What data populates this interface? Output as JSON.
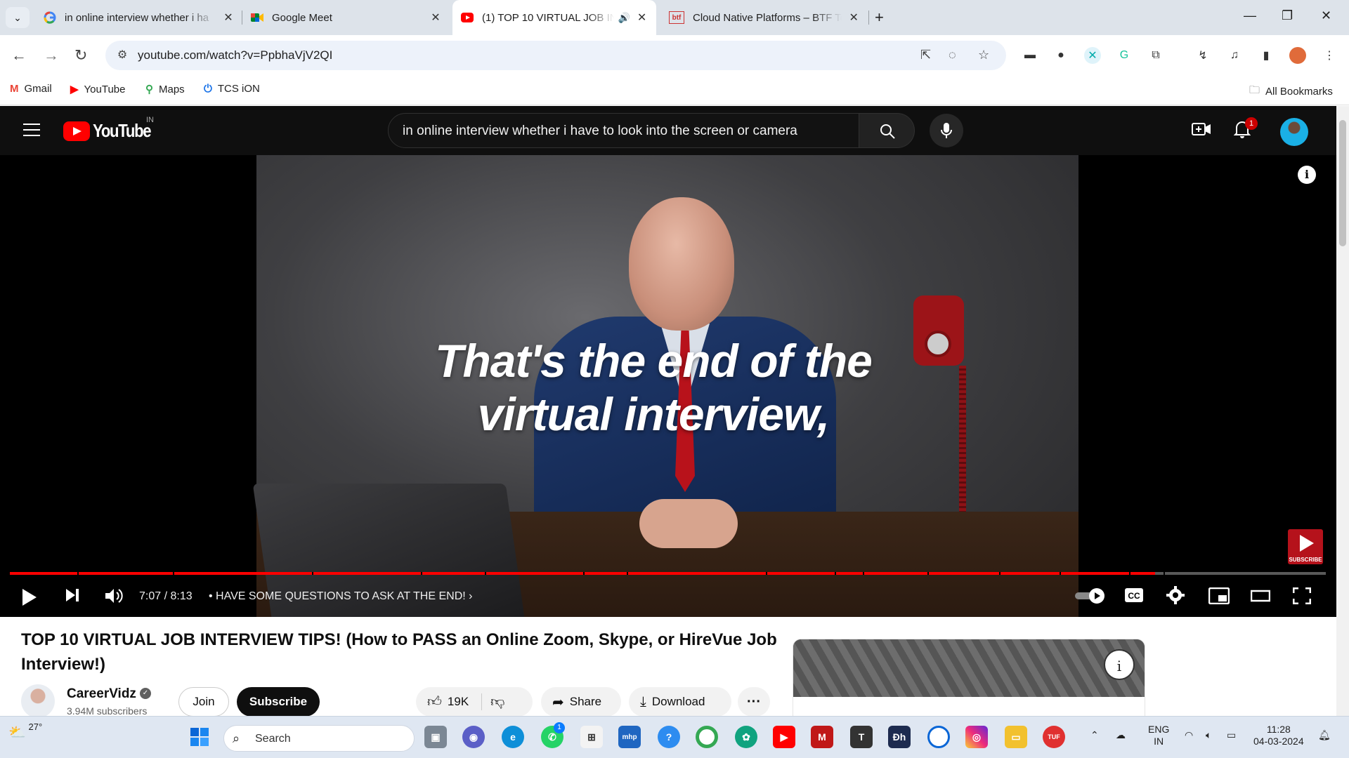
{
  "browser": {
    "tabs": [
      {
        "title": "in online interview whether i ha",
        "favicon": "google-icon",
        "active": false
      },
      {
        "title": "Google Meet",
        "favicon": "google-meet-icon",
        "active": false
      },
      {
        "title": "(1) TOP 10 VIRTUAL JOB INT",
        "favicon": "youtube-icon",
        "active": true,
        "audio": true
      },
      {
        "title": "Cloud Native Platforms – BTF Te",
        "favicon": "btf-icon",
        "active": false
      }
    ],
    "url": "youtube.com/watch?v=PpbhaVjV2QI",
    "bookmarks": [
      {
        "label": "Gmail",
        "icon": "gmail-icon"
      },
      {
        "label": "YouTube",
        "icon": "youtube-icon"
      },
      {
        "label": "Maps",
        "icon": "maps-icon"
      },
      {
        "label": "TCS iON",
        "icon": "power-icon"
      }
    ],
    "all_bookmarks_label": "All Bookmarks"
  },
  "youtube": {
    "logo_text": "YouTube",
    "country_code": "IN",
    "search_query": "in online interview whether i have to look into the screen or camera",
    "notification_count": "1"
  },
  "player": {
    "caption_line1": "That's the end of the",
    "caption_line2": "virtual interview,",
    "watermark_label": "SUBSCRIBE",
    "time": "7:07 / 8:13",
    "chapter": "HAVE SOME QUESTIONS TO ASK AT THE END!",
    "progress_fraction": 0.87,
    "accent_color": "#ff0000"
  },
  "video": {
    "title": "TOP 10 VIRTUAL JOB INTERVIEW TIPS! (How to PASS an Online Zoom, Skype, or HireVue Job Interview!)",
    "channel_name": "CareerVidz",
    "subscribers": "3.94M subscribers",
    "join_label": "Join",
    "subscribe_label": "Subscribe",
    "likes": "19K",
    "share_label": "Share",
    "download_label": "Download"
  },
  "taskbar": {
    "temperature": "27°",
    "search_placeholder": "Search",
    "language_line1": "ENG",
    "language_line2": "IN",
    "time": "11:28",
    "date": "04-03-2024",
    "whatsapp_badge": "1"
  }
}
